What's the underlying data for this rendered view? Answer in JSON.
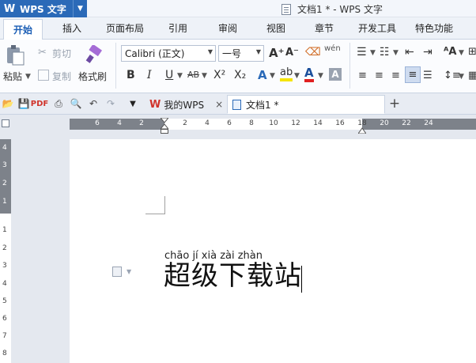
{
  "titlebar": {
    "app_name": "WPS 文字",
    "doc_title": "文档1 * - WPS 文字"
  },
  "menu": {
    "tabs": [
      "开始",
      "插入",
      "页面布局",
      "引用",
      "审阅",
      "视图",
      "章节",
      "开发工具",
      "特色功能"
    ]
  },
  "ribbon": {
    "paste": "粘贴",
    "cut": "剪切",
    "copy": "复制",
    "format_painter": "格式刷",
    "font_name": "Calibri (正文)",
    "font_size": "一号"
  },
  "doc_tabs": {
    "home": "我的WPS",
    "current": "文档1 *"
  },
  "ruler": {
    "h_numbers": [
      "6",
      "4",
      "2",
      "2",
      "4",
      "6",
      "8",
      "10",
      "12",
      "14",
      "16",
      "18",
      "20",
      "22",
      "24"
    ],
    "v_numbers": [
      "4",
      "3",
      "2",
      "1",
      "1",
      "2",
      "3",
      "4",
      "5",
      "6",
      "7",
      "8"
    ]
  },
  "document": {
    "pinyin": "chāo jí xià zài zhàn",
    "text": "超级下载站"
  },
  "colors": {
    "accent": "#2b6ab8",
    "highlight": "#f5e400",
    "font_color": "#e02020"
  }
}
